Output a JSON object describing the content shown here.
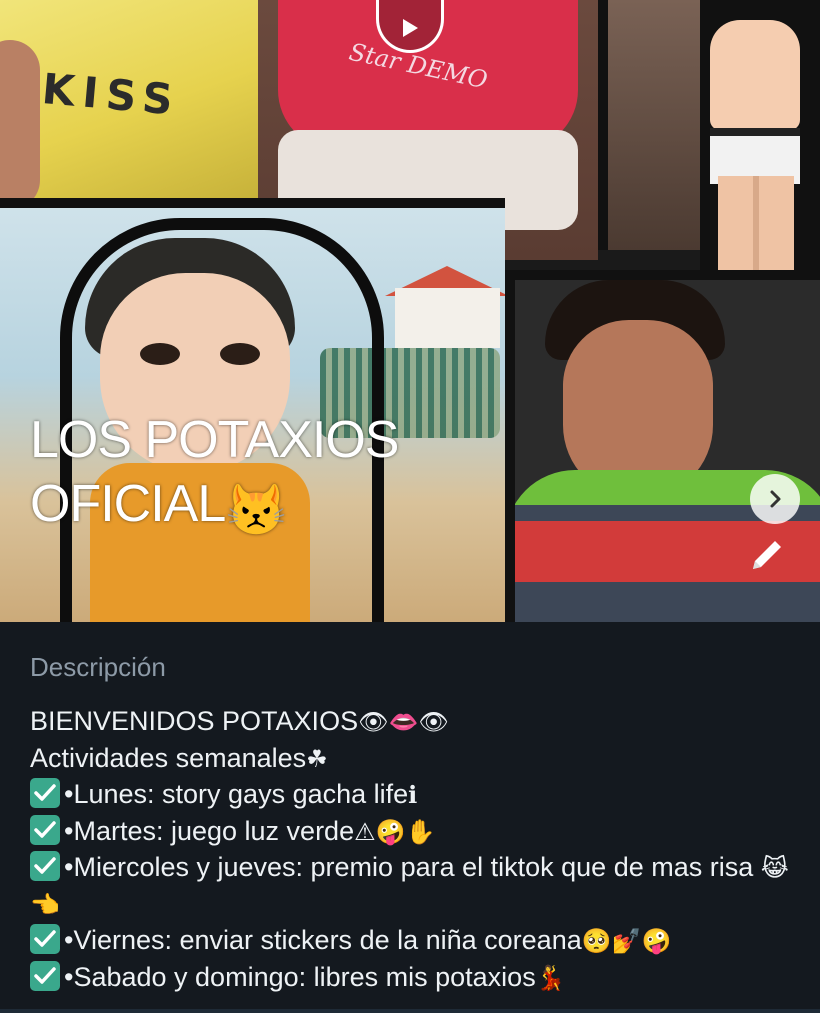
{
  "header": {
    "collage_text": {
      "kiss": "KISS",
      "shirt_print": "Star DEMO"
    },
    "group_name_line1": "LOS POTAXIOS",
    "group_name_line2": "OFICIAL",
    "group_name_emoji": "😾"
  },
  "icons": {
    "play": "play-icon",
    "next": "chevron-right-icon",
    "edit": "pencil-icon",
    "check": "check-mark-icon"
  },
  "colors": {
    "background": "#14191f",
    "label": "#8d9aa7",
    "text": "#eef2f5",
    "check": "#3aa88c"
  },
  "description": {
    "label": "Descripción",
    "lines": [
      {
        "text": "BIENVENIDOS POTAXIOS",
        "emoji": "👁👄👁"
      },
      {
        "text": "Actividades semanales",
        "emoji": "☘"
      },
      {
        "text": "•Lunes: story gays gacha life",
        "emoji": "ℹ",
        "checked": true
      },
      {
        "text": "•Martes: juego luz verde",
        "emoji": "⚠🤪✋",
        "checked": true
      },
      {
        "text": "•Miercoles y jueves: premio para el tiktok que de mas risa",
        "emoji": "😹👈",
        "checked": true
      },
      {
        "text": "•Viernes: enviar stickers de la niña coreana",
        "emoji": "🥺💅🤪",
        "checked": true
      },
      {
        "text": "•Sabado y domingo: libres mis potaxios",
        "emoji": "💃",
        "checked": true
      }
    ]
  }
}
